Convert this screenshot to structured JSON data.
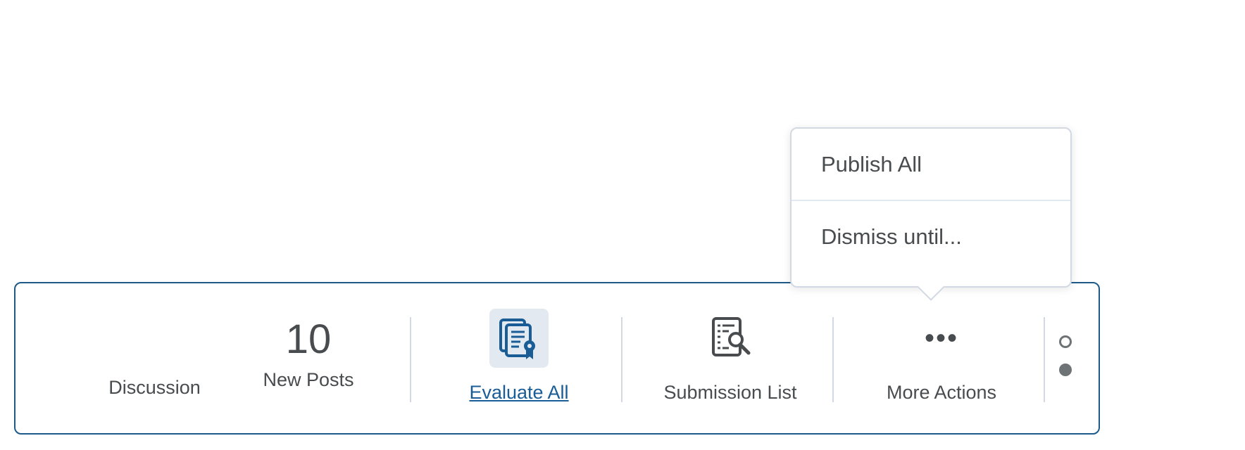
{
  "activity": {
    "type_label": "Discussion",
    "count": "10",
    "count_label": "New Posts"
  },
  "actions": [
    {
      "label": "Evaluate All",
      "icon": "evaluate-all-icon",
      "active": true
    },
    {
      "label": "Submission List",
      "icon": "submission-list-icon",
      "active": false
    },
    {
      "label": "More Actions",
      "icon": "more-actions-icon",
      "active": false
    }
  ],
  "more_menu": {
    "items": [
      "Publish All",
      "Dismiss until..."
    ]
  },
  "colors": {
    "card_border": "#1d5a8a",
    "link": "#1a5d96",
    "icon_active_bg": "#e3e9f1",
    "text": "#494c4e"
  }
}
